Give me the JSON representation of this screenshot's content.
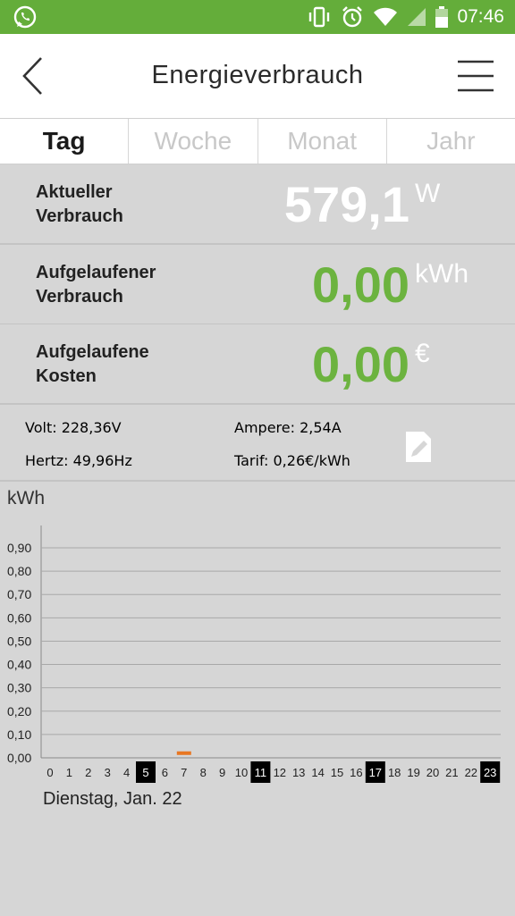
{
  "status_bar": {
    "time": "07:46",
    "icons": [
      "whatsapp-icon",
      "vibrate-icon",
      "alarm-icon",
      "wifi-icon",
      "signal-icon",
      "battery-icon"
    ]
  },
  "header": {
    "title": "Energieverbrauch",
    "back_icon": "chevron-left-icon",
    "menu_icon": "hamburger-menu-icon"
  },
  "tabs": [
    {
      "label": "Tag",
      "active": true
    },
    {
      "label": "Woche",
      "active": false
    },
    {
      "label": "Monat",
      "active": false
    },
    {
      "label": "Jahr",
      "active": false
    }
  ],
  "metrics": [
    {
      "label_line1": "Aktueller",
      "label_line2": "Verbrauch",
      "value": "579,1",
      "unit": "W",
      "value_color": "#ffffff"
    },
    {
      "label_line1": "Aufgelaufener",
      "label_line2": "Verbrauch",
      "value": "0,00",
      "unit": "kWh",
      "value_color": "#6cb33f"
    },
    {
      "label_line1": "Aufgelaufene",
      "label_line2": "Kosten",
      "value": "0,00",
      "unit": "€",
      "value_color": "#6cb33f"
    }
  ],
  "info": {
    "volt": "Volt: 228,36V",
    "ampere": "Ampere: 2,54A",
    "hertz": "Hertz: 49,96Hz",
    "tarif": "Tarif: 0,26€/kWh",
    "edit_icon": "edit-icon"
  },
  "chart_unit": "kWh",
  "chart_data": {
    "type": "bar",
    "categories": [
      "0",
      "1",
      "2",
      "3",
      "4",
      "5",
      "6",
      "7",
      "8",
      "9",
      "10",
      "11",
      "12",
      "13",
      "14",
      "15",
      "16",
      "17",
      "18",
      "19",
      "20",
      "21",
      "22",
      "23"
    ],
    "values": [
      0,
      0,
      0,
      0,
      0,
      0,
      0,
      0.02,
      0,
      0,
      0,
      0,
      0,
      0,
      0,
      0,
      0,
      0,
      0,
      0,
      0,
      0,
      0,
      0
    ],
    "highlighted_categories": [
      "5",
      "11",
      "17",
      "23"
    ],
    "ylabel": "kWh",
    "ylim": [
      0,
      0.9
    ],
    "yticks": [
      "0,00",
      "0,10",
      "0,20",
      "0,30",
      "0,40",
      "0,50",
      "0,60",
      "0,70",
      "0,80",
      "0,90"
    ],
    "grid": true,
    "bar_color": "#e87722"
  },
  "date_label": "Dienstag, Jan. 22",
  "colors": {
    "status_green": "#64ad3a",
    "value_green": "#6cb33f",
    "background": "#d6d6d6",
    "bar_orange": "#e87722"
  }
}
